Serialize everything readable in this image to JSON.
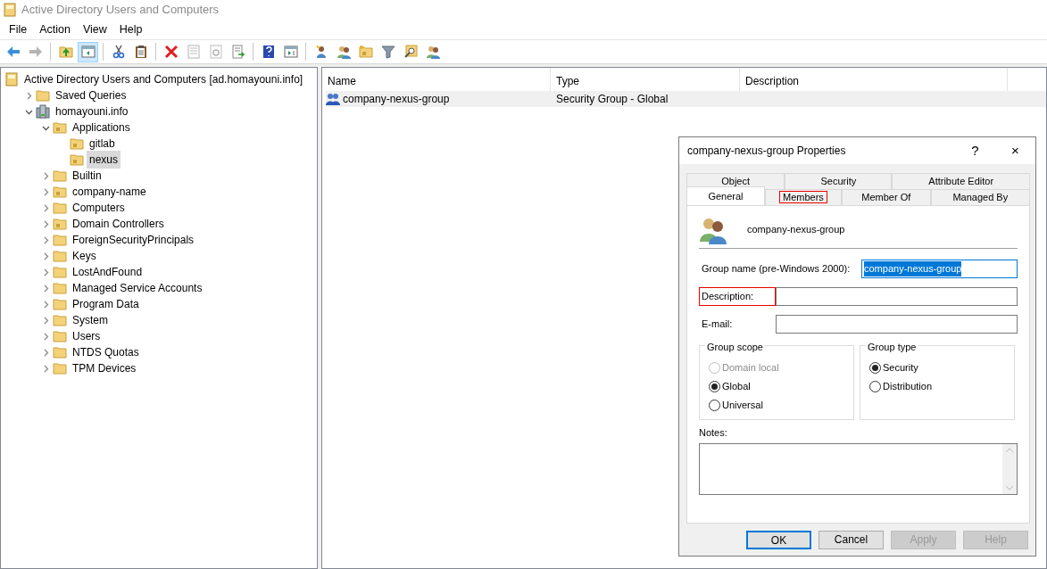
{
  "window": {
    "title": "Active Directory Users and Computers"
  },
  "menu": [
    "File",
    "Action",
    "View",
    "Help"
  ],
  "toolbar": [
    {
      "kind": "back",
      "disabled": false,
      "pressed": false
    },
    {
      "kind": "forward",
      "disabled": true,
      "pressed": false
    },
    {
      "kind": "sep"
    },
    {
      "kind": "up",
      "disabled": false,
      "pressed": false
    },
    {
      "kind": "tree",
      "disabled": false,
      "pressed": true
    },
    {
      "kind": "sep"
    },
    {
      "kind": "cut",
      "disabled": false,
      "pressed": false
    },
    {
      "kind": "paste",
      "disabled": false,
      "pressed": false
    },
    {
      "kind": "sep"
    },
    {
      "kind": "delete",
      "disabled": false,
      "pressed": false
    },
    {
      "kind": "properties",
      "disabled": true,
      "pressed": false
    },
    {
      "kind": "refresh",
      "disabled": true,
      "pressed": false
    },
    {
      "kind": "export",
      "disabled": false,
      "pressed": false
    },
    {
      "kind": "sep"
    },
    {
      "kind": "help",
      "disabled": false,
      "pressed": false
    },
    {
      "kind": "pane",
      "disabled": false,
      "pressed": false
    },
    {
      "kind": "sep"
    },
    {
      "kind": "user",
      "disabled": false,
      "pressed": false
    },
    {
      "kind": "group",
      "disabled": false,
      "pressed": false
    },
    {
      "kind": "ou",
      "disabled": false,
      "pressed": false
    },
    {
      "kind": "filter",
      "disabled": false,
      "pressed": false
    },
    {
      "kind": "find",
      "disabled": false,
      "pressed": false
    },
    {
      "kind": "addgroup",
      "disabled": false,
      "pressed": false
    }
  ],
  "tree": [
    {
      "label": "Active Directory Users and Computers [ad.homayouni.info]",
      "kind": "root",
      "selected": false,
      "children": [
        {
          "label": "Saved Queries",
          "kind": "folder",
          "selected": false,
          "expanded": false
        },
        {
          "label": "homayouni.info",
          "kind": "domain",
          "selected": false,
          "expanded": true,
          "children": [
            {
              "label": "Applications",
              "kind": "ou",
              "selected": false,
              "expanded": true,
              "children": [
                {
                  "label": "gitlab",
                  "kind": "ou",
                  "selected": false
                },
                {
                  "label": "nexus",
                  "kind": "ou",
                  "selected": true
                }
              ]
            },
            {
              "label": "Builtin",
              "kind": "folder",
              "selected": false,
              "expanded": false
            },
            {
              "label": "company-name",
              "kind": "ou",
              "selected": false,
              "expanded": false
            },
            {
              "label": "Computers",
              "kind": "folder",
              "selected": false,
              "expanded": false
            },
            {
              "label": "Domain Controllers",
              "kind": "ou",
              "selected": false,
              "expanded": false
            },
            {
              "label": "ForeignSecurityPrincipals",
              "kind": "folder",
              "selected": false,
              "expanded": false
            },
            {
              "label": "Keys",
              "kind": "folder",
              "selected": false,
              "expanded": false
            },
            {
              "label": "LostAndFound",
              "kind": "folder",
              "selected": false,
              "expanded": false
            },
            {
              "label": "Managed Service Accounts",
              "kind": "folder",
              "selected": false,
              "expanded": false
            },
            {
              "label": "Program Data",
              "kind": "folder",
              "selected": false,
              "expanded": false
            },
            {
              "label": "System",
              "kind": "folder",
              "selected": false,
              "expanded": false
            },
            {
              "label": "Users",
              "kind": "folder",
              "selected": false,
              "expanded": false
            },
            {
              "label": "NTDS Quotas",
              "kind": "folder",
              "selected": false,
              "expanded": false
            },
            {
              "label": "TPM Devices",
              "kind": "folder",
              "selected": false,
              "expanded": false
            }
          ]
        }
      ]
    }
  ],
  "list": {
    "columns": [
      "Name",
      "Type",
      "Description"
    ],
    "rows": [
      {
        "name": "company-nexus-group",
        "type": "Security Group - Global",
        "selected": true
      }
    ]
  },
  "dialog": {
    "title": "company-nexus-group Properties",
    "help": "?",
    "close": "×",
    "tab_rows": [
      [
        {
          "label": "Object",
          "selected": false,
          "highlighted": false
        },
        {
          "label": "Security",
          "selected": false,
          "highlighted": false
        },
        {
          "label": "Attribute Editor",
          "selected": false,
          "highlighted": false
        }
      ],
      [
        {
          "label": "General",
          "selected": true,
          "highlighted": false
        },
        {
          "label": "Members",
          "selected": false,
          "highlighted": true
        },
        {
          "label": "Member Of",
          "selected": false,
          "highlighted": false
        },
        {
          "label": "Managed By",
          "selected": false,
          "highlighted": false
        }
      ]
    ],
    "group_name": "company-nexus-group",
    "fields": [
      {
        "label": "Group name (pre-Windows 2000):",
        "value": "company-nexus-group",
        "focused": true,
        "highlighted": false
      },
      {
        "label": "Description:",
        "focused": false,
        "highlighted": true
      },
      {
        "label": "E-mail:",
        "focused": false,
        "highlighted": false
      }
    ],
    "group_scope": {
      "title": "Group scope",
      "options": [
        {
          "label": "Domain local",
          "selected": false,
          "disabled": true
        },
        {
          "label": "Global",
          "selected": true,
          "disabled": false
        },
        {
          "label": "Universal",
          "selected": false,
          "disabled": false
        }
      ]
    },
    "group_type": {
      "title": "Group type",
      "options": [
        {
          "label": "Security",
          "selected": true,
          "disabled": false
        },
        {
          "label": "Distribution",
          "selected": false,
          "disabled": false
        }
      ]
    },
    "notes_label": "Notes:",
    "buttons": [
      {
        "label": "OK",
        "default": true,
        "disabled": false
      },
      {
        "label": "Cancel",
        "default": false,
        "disabled": false
      },
      {
        "label": "Apply",
        "default": false,
        "disabled": true
      },
      {
        "label": "Help",
        "default": false,
        "disabled": true
      }
    ]
  }
}
